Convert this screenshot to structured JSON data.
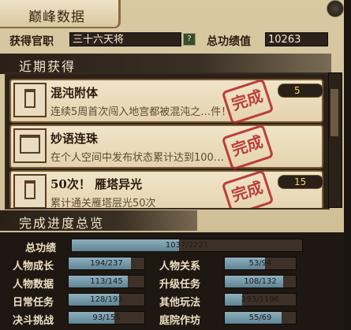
{
  "title": "巅峰数据",
  "official_title_label": "获得官职",
  "official_title_value": "三十六天将",
  "help_label": "?",
  "total_score_label": "总功绩值",
  "total_score_value": "10263",
  "recent_section": "近期获得",
  "recent_items": [
    {
      "name": "混沌附体",
      "desc": "连续5周首次闯入地宫都被混沌之…件！",
      "points": "5",
      "stamp": "完成"
    },
    {
      "name": "妙语连珠",
      "desc": "在个人空间中发布状态累计达到100…",
      "points": "",
      "stamp": "完成"
    },
    {
      "name": "50次！ 雁塔异光",
      "desc": "累计通关雁塔层光50次",
      "points": "15",
      "stamp": "完成"
    }
  ],
  "progress_section": "完成进度总览",
  "total": {
    "label": "总功绩",
    "text": "1037/2221",
    "value": 1037,
    "max": 2221
  },
  "progress_rows": [
    {
      "label": "人物成长",
      "text": "194/237",
      "value": 194,
      "max": 237
    },
    {
      "label": "人物关系",
      "text": "53/94",
      "value": 53,
      "max": 94
    },
    {
      "label": "人物数据",
      "text": "113/145",
      "value": 113,
      "max": 145
    },
    {
      "label": "升级任务",
      "text": "108/132",
      "value": 108,
      "max": 132
    },
    {
      "label": "日常任务",
      "text": "128/193",
      "value": 128,
      "max": 193
    },
    {
      "label": "其他玩法",
      "text": "293/1196",
      "value": 293,
      "max": 1196
    },
    {
      "label": "决斗挑战",
      "text": "93/155",
      "value": 93,
      "max": 155
    },
    {
      "label": "庭院作坊",
      "text": "55/69",
      "value": 55,
      "max": 69
    }
  ],
  "colors": {
    "stamp": "#b32323",
    "bar_fill": "#7fa3b3",
    "points_text": "#f5d75a"
  }
}
